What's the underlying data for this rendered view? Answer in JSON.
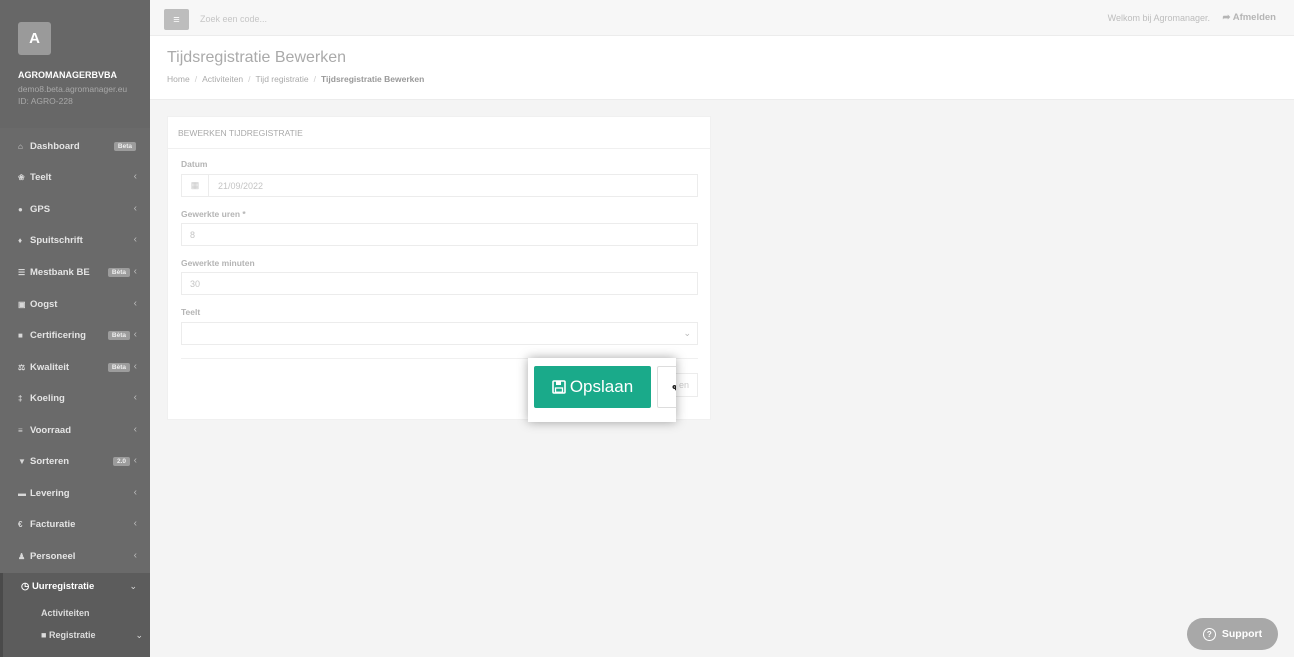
{
  "sidebar": {
    "avatar_letter": "A",
    "company": "AGROMANAGERBVBA",
    "domain": "demo8.beta.agromanager.eu",
    "account_id": "ID: AGRO-228",
    "items": [
      {
        "label": "Dashboard",
        "icon": "home-icon",
        "badge": "Beta"
      },
      {
        "label": "Teelt",
        "icon": "leaf-icon"
      },
      {
        "label": "GPS",
        "icon": "map-marker-icon"
      },
      {
        "label": "Spuitschrift",
        "icon": "droplet-icon"
      },
      {
        "label": "Mestbank BE",
        "icon": "bank-icon",
        "badge": "Bèta"
      },
      {
        "label": "Oogst",
        "icon": "basket-icon"
      },
      {
        "label": "Certificering",
        "icon": "book-icon",
        "badge": "Bèta"
      },
      {
        "label": "Kwaliteit",
        "icon": "scale-icon",
        "badge": "Bèta"
      },
      {
        "label": "Koeling",
        "icon": "thermometer-icon"
      },
      {
        "label": "Voorraad",
        "icon": "list-icon"
      },
      {
        "label": "Sorteren",
        "icon": "filter-icon",
        "badge": "2.0"
      },
      {
        "label": "Levering",
        "icon": "truck-icon"
      },
      {
        "label": "Facturatie",
        "icon": "euro-icon"
      },
      {
        "label": "Personeel",
        "icon": "user-icon"
      }
    ],
    "active_section": {
      "label": "Uurregistratie",
      "icon": "clock-icon",
      "subitems": [
        {
          "label": "Activiteiten"
        },
        {
          "label": "Registratie",
          "icon": "folder-open-icon"
        }
      ]
    }
  },
  "topbar": {
    "search_placeholder": "Zoek een code...",
    "welcome": "Welkom bij Agromanager.",
    "logout": "Afmelden"
  },
  "header": {
    "title": "Tijdsregistratie Bewerken",
    "breadcrumb": [
      "Home",
      "Activiteiten",
      "Tijd registratie",
      "Tijdsregistratie Bewerken"
    ]
  },
  "form": {
    "title": "BEWERKEN TIJDREGISTRATIE",
    "fields": {
      "datum": {
        "label": "Datum",
        "value": "21/09/2022"
      },
      "uren": {
        "label": "Gewerkte uren *",
        "value": "8"
      },
      "minuten": {
        "label": "Gewerkte minuten",
        "value": "30"
      },
      "teelt": {
        "label": "Teelt",
        "value": ""
      }
    },
    "save_label": "Opslaan",
    "secondary_partial": "en"
  },
  "support_label": "Support",
  "colors": {
    "sidebar_bg": "#6a6a6a",
    "save_button": "#1aaa8a",
    "support_bg": "#a8a8a8"
  }
}
